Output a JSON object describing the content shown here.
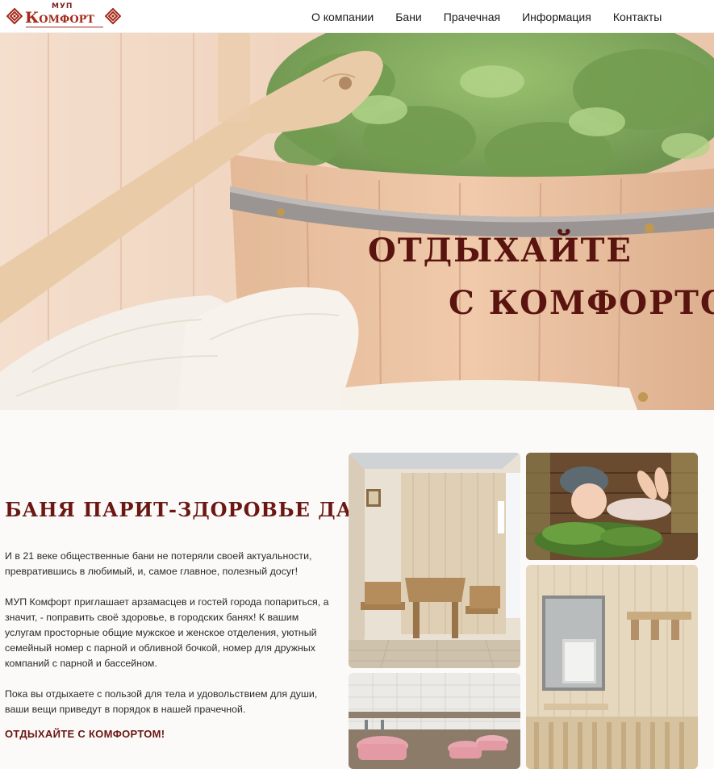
{
  "header": {
    "logo": {
      "small": "МУП",
      "big": "Комфорт"
    },
    "nav": [
      {
        "label": "О компании"
      },
      {
        "label": "Бани"
      },
      {
        "label": "Прачечная"
      },
      {
        "label": "Информация"
      },
      {
        "label": "Контакты"
      }
    ]
  },
  "hero": {
    "line1": "ОТДЫХАЙТЕ",
    "line2": "С КОМФОРТОМ"
  },
  "main": {
    "title": "БАНЯ ПАРИТ-ЗДОРОВЬЕ ДАРИТ!",
    "p1": "И в 21 веке общественные бани не потеряли своей актуальности, превратившись в любимый, и, самое главное, полезный досуг!",
    "p2": "МУП Комфорт приглашает арзамасцев и гостей города попариться, а значит, - поправить своё здоровье, в городских банях! К вашим услугам просторные общие мужское и женское отделения, уютный семейный номер с парной и обливной бочкой, номер для дружных компаний с парной и бассейном.",
    "p3": "Пока вы отдыхаете с пользой для тела и удовольствием для души, ваши вещи приведут в порядок в нашей прачечной.",
    "cta": "ОТДЫХАЙТЕ С КОМФОРТОМ!"
  },
  "colors": {
    "brand": "#a52a1c",
    "title": "#6b1712",
    "hero_text": "#5a1410"
  },
  "icons": [
    "ornament-icon"
  ]
}
